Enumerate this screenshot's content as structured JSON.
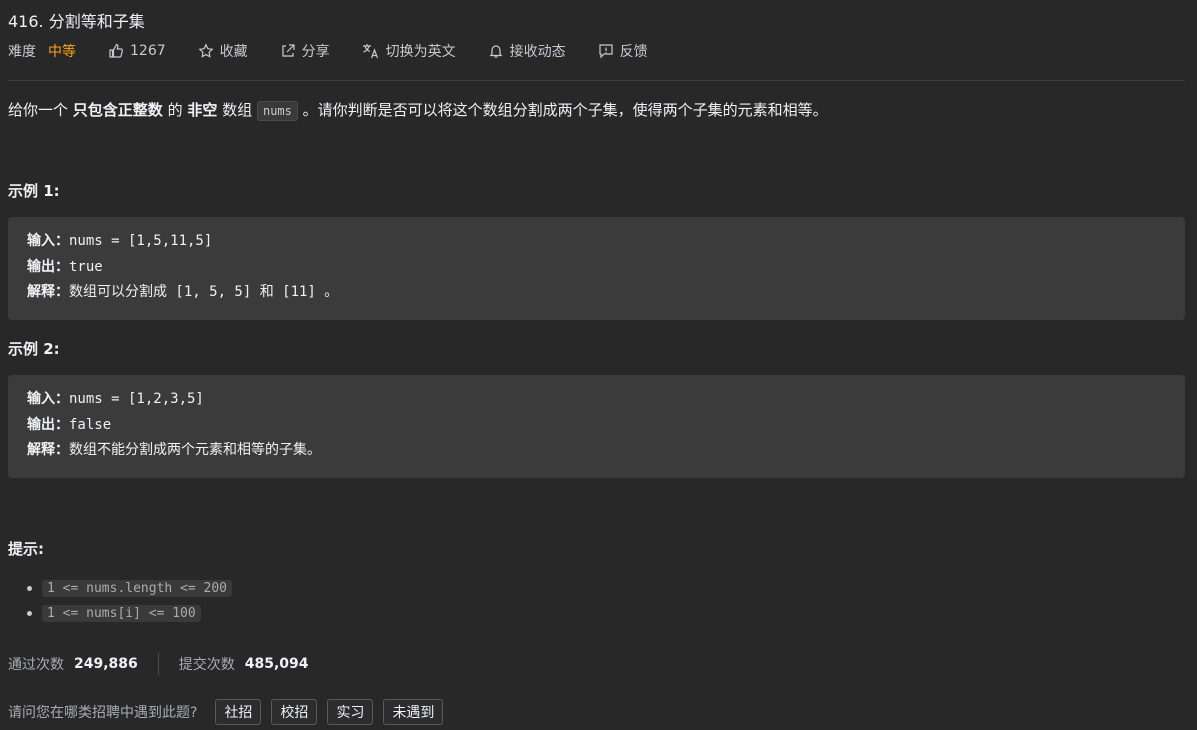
{
  "problem": {
    "title": "416. 分割等和子集",
    "difficulty_label": "难度",
    "difficulty": "中等",
    "likes": "1267",
    "favorite_label": "收藏",
    "share_label": "分享",
    "translate_label": "切换为英文",
    "subscribe_label": "接收动态",
    "feedback_label": "反馈"
  },
  "description": {
    "p1": "给你一个",
    "b1": "只包含正整数",
    "p2": "的",
    "b2": "非空",
    "p3": "数组",
    "code": "nums",
    "p4": "。请你判断是否可以将这个数组分割成两个子集，使得两个子集的元素和相等。"
  },
  "examples": [
    {
      "heading": "示例 1:",
      "input_label": "输入：",
      "input": "nums = [1,5,11,5]",
      "output_label": "输出：",
      "output": "true",
      "explain_label": "解释：",
      "explain_a": "数组可以分割成",
      "explain_b": " [1, 5, 5] ",
      "explain_c": "和",
      "explain_d": " [11] ",
      "explain_e": "。"
    },
    {
      "heading": "示例 2:",
      "input_label": "输入：",
      "input": "nums = [1,2,3,5]",
      "output_label": "输出：",
      "output": "false",
      "explain_label": "解释：",
      "explain": "数组不能分割成两个元素和相等的子集。"
    }
  ],
  "hints": {
    "heading": "提示:",
    "items": [
      "1 <= nums.length <= 200",
      "1 <= nums[i] <= 100"
    ]
  },
  "stats": {
    "accepted_label": "通过次数",
    "accepted": "249,886",
    "submissions_label": "提交次数",
    "submissions": "485,094"
  },
  "asked": {
    "question": "请问您在哪类招聘中遇到此题?",
    "tags": [
      "社招",
      "校招",
      "实习",
      "未遇到"
    ]
  },
  "colors": {
    "background": "#282828",
    "difficulty_medium": "#ffa116",
    "code_block_bg": "#3b3b3b"
  },
  "icons": [
    "thumbs-up-icon",
    "star-icon",
    "share-icon",
    "translate-icon",
    "bell-icon",
    "feedback-icon"
  ]
}
